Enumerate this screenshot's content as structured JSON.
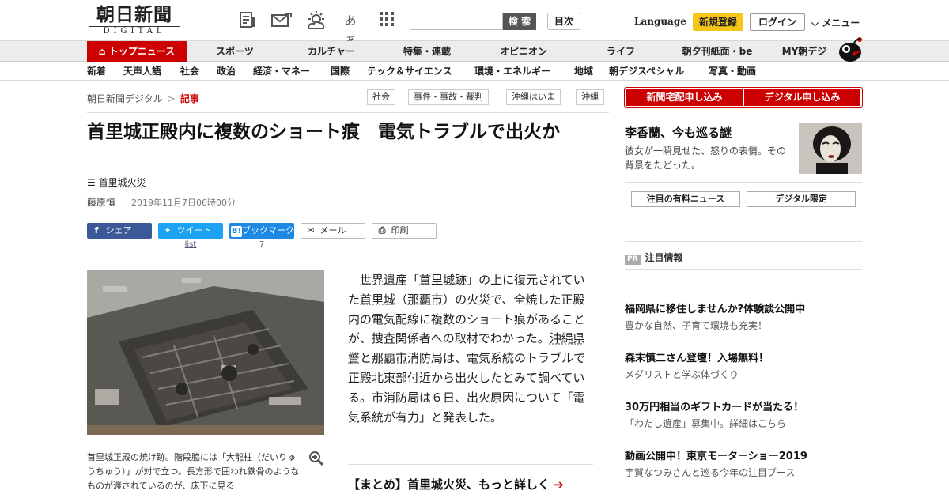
{
  "header": {
    "logo_kanji": "朝日新聞",
    "logo_digital": "DIGITAL",
    "icons": [
      "newspaper-icon",
      "email-icon",
      "weather-icon",
      "font-size-icon",
      "grid-menu-icon"
    ],
    "font_size_label": "あぁ",
    "search": {
      "placeholder": "",
      "button": "検 索"
    },
    "mokuji": "目次",
    "language": "Language",
    "register": "新規登録",
    "login": "ログイン",
    "menu": "メニュー"
  },
  "nav_primary": [
    "トップニュース",
    "スポーツ",
    "カルチャー",
    "特集・連載",
    "オピニオン",
    "ライフ",
    "朝夕刊紙面・be",
    "MY朝デジ"
  ],
  "nav_secondary": [
    "新着",
    "天声人語",
    "社会",
    "政治",
    "経済・マネー",
    "国際",
    "テック＆サイエンス",
    "環境・エネルギー",
    "地域",
    "朝デジスペシャル",
    "写真・動画"
  ],
  "breadcrumb": {
    "home": "朝日新聞デジタル",
    "sep": ">",
    "current": "記事"
  },
  "tags": [
    "社会",
    "事件・事故・裁判",
    "沖縄はいま",
    "沖縄"
  ],
  "article": {
    "title": "首里城正殿内に複数のショート痕　電気トラブルで出火か",
    "topic": "首里城火災",
    "author": "藤原慎一",
    "date": "2019年11月7日06時00分",
    "share": {
      "facebook": "シェア",
      "twitter": "ツイート",
      "hatena": "ブックマーク",
      "mail": "メール",
      "print": "印刷",
      "twitter_count": "list",
      "hatena_count": "7"
    },
    "caption": "首里城正殿の焼け跡。階段脇には「大龍柱（だいりゅうちゅう）」が対で立つ。長方形で囲われ鉄骨のようなものが渡されているのが、床下に見る",
    "body": [
      {
        "t": "　"
      },
      {
        "t": "世界遺産",
        "link": true
      },
      {
        "t": "「"
      },
      {
        "t": "首里城",
        "link": true
      },
      {
        "t": "跡",
        "link": true
      },
      {
        "t": "」の上に復元されていた"
      },
      {
        "t": "首里城",
        "link": true
      },
      {
        "t": "（"
      },
      {
        "t": "那覇市",
        "link": true
      },
      {
        "t": "）の火災で、全焼した正殿内の電気配線に複数のショート痕があることが、捜査関係者への取材でわかった。"
      },
      {
        "t": "沖縄県警",
        "link": true
      },
      {
        "t": "と"
      },
      {
        "t": "那覇市",
        "link": true
      },
      {
        "t": "消防局は、電気系統のトラブルで正殿北東部付近から出火したとみて調べている。市消防局は６日、出火原因について「電気系統が有力」と発表した。"
      }
    ],
    "matome": "【まとめ】首里城火災、もっと詳しく",
    "matome_arrow": "➔"
  },
  "sidebar": {
    "subscribe_paper": "新聞宅配申し込み",
    "subscribe_digital": "デジタル申し込み",
    "feature": {
      "title": "李香蘭、今も巡る謎",
      "text": "彼女が一瞬見せた、怒りの表情。その背景をたどった。"
    },
    "btn_paid": "注目の有料ニュース",
    "btn_digital": "デジタル限定",
    "pr_badge": "PR",
    "pr_title": "注目情報",
    "ads": [
      {
        "title": "福岡県に移住しませんか?体験談公開中",
        "sub": "豊かな自然、子育て環境も充実！"
      },
      {
        "title": "森末慎二さん登壇！入場無料！",
        "sub": "メダリストと学ぶ体づくり"
      },
      {
        "title": "30万円相当のギフトカードが当たる！",
        "sub": "「わたし遺産」募集中。詳細はこちら"
      },
      {
        "title": "動画公開中！東京モーターショー2019",
        "sub": "宇賀なつみさんと巡る今年の注目ブース"
      }
    ]
  },
  "colors": {
    "accent_red": "#cc0000",
    "register_yellow": "#f5c518",
    "facebook": "#3b5998",
    "twitter": "#1da1f2",
    "hatena": "#1e88e5"
  }
}
